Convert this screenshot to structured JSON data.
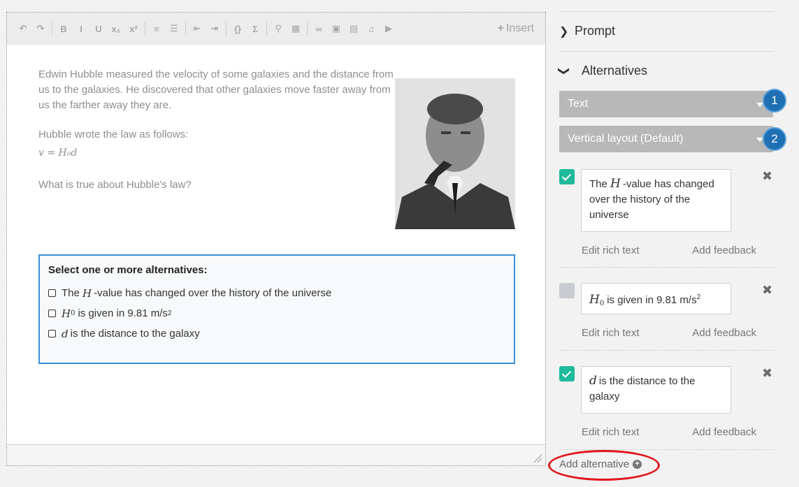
{
  "toolbar": {
    "buttons": [
      {
        "name": "undo-icon",
        "glyph": "↶"
      },
      {
        "name": "redo-icon",
        "glyph": "↷"
      },
      {
        "name": "bold-icon",
        "glyph": "B"
      },
      {
        "name": "italic-icon",
        "glyph": "I"
      },
      {
        "name": "underline-icon",
        "glyph": "U"
      },
      {
        "name": "subscript-icon",
        "glyph": "x₂"
      },
      {
        "name": "superscript-icon",
        "glyph": "x²"
      },
      {
        "name": "numbered-list-icon",
        "glyph": "≡"
      },
      {
        "name": "bullet-list-icon",
        "glyph": "☰"
      },
      {
        "name": "outdent-icon",
        "glyph": "⇤"
      },
      {
        "name": "indent-icon",
        "glyph": "⇥"
      },
      {
        "name": "code-icon",
        "glyph": "{}"
      },
      {
        "name": "math-icon",
        "glyph": "Σ"
      },
      {
        "name": "attachment-icon",
        "glyph": "⚲"
      },
      {
        "name": "table-icon",
        "glyph": "▦"
      },
      {
        "name": "link-icon",
        "glyph": "∞"
      },
      {
        "name": "image-icon",
        "glyph": "▣"
      },
      {
        "name": "pdf-icon",
        "glyph": "▤"
      },
      {
        "name": "audio-icon",
        "glyph": "♫"
      },
      {
        "name": "video-icon",
        "glyph": "▶"
      }
    ],
    "insert_label": "Insert"
  },
  "question": {
    "intro": "Edwin Hubble measured the velocity of some galaxies and the distance from us to the galaxies. He discovered that other galaxies move faster away from us the farther away they are.",
    "law_intro": "Hubble wrote the law as follows:",
    "formula": "v = H₀d",
    "prompt": "What is true about Hubble's law?",
    "box_title": "Select one or more alternatives:",
    "alt1_pre": "The",
    "alt1_var": "H",
    "alt1_post": "-value has changed over the history of the universe",
    "alt2_var": "H",
    "alt2_sub": "0",
    "alt2_post": "is given in 9.81 m/s",
    "alt2_sup": "2",
    "alt3_var": "d",
    "alt3_post": "is the distance to the galaxy"
  },
  "panel": {
    "prompt_label": "Prompt",
    "alternatives_label": "Alternatives",
    "type_dropdown": "Text",
    "layout_dropdown": "Vertical layout (Default)",
    "badge1": "1",
    "badge2": "2",
    "alternatives": [
      {
        "checked": true,
        "var": "H",
        "text_pre": "The",
        "text_post": "-value has changed over the history of the universe"
      },
      {
        "checked": false,
        "var": "H",
        "sub": "0",
        "text_post": "is given in 9.81 m/s",
        "sup": "2"
      },
      {
        "checked": true,
        "var": "d",
        "text_post": "is the distance to the galaxy"
      }
    ],
    "edit_rich_text": "Edit rich text",
    "add_feedback": "Add feedback",
    "add_alternative": "Add alternative"
  },
  "colors": {
    "accent_blue": "#3a8fd8",
    "check_green": "#1fb99b",
    "badge_blue": "#1f6fb3",
    "highlight_red": "#e0161b"
  }
}
